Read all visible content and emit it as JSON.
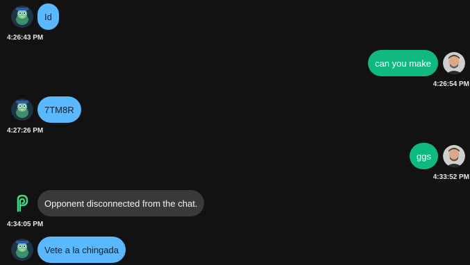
{
  "messages": [
    {
      "side": "left",
      "avatar": "duck-mascot-avatar",
      "text": "Id",
      "time": "4:26:43 PM"
    },
    {
      "side": "right",
      "avatar": "user-photo-avatar",
      "text": "can you make",
      "time": "4:26:54 PM"
    },
    {
      "side": "left",
      "avatar": "duck-mascot-avatar",
      "text": "7TM8R",
      "time": "4:27:26 PM"
    },
    {
      "side": "right",
      "avatar": "user-photo-avatar",
      "text": "ggs",
      "time": "4:33:52 PM"
    },
    {
      "side": "left",
      "avatar": "system-logo-icon",
      "text": "Opponent disconnected from the chat.",
      "time": "4:34:05 PM"
    },
    {
      "side": "left",
      "avatar": "duck-mascot-avatar",
      "text": "Vete a la chingada",
      "time": ""
    }
  ],
  "colors": {
    "background": "#121212",
    "incoming_bubble": "#5ab8ff",
    "outgoing_bubble": "#10b981",
    "system_bubble": "#3a3a3a",
    "system_logo": "#3ddc84"
  }
}
